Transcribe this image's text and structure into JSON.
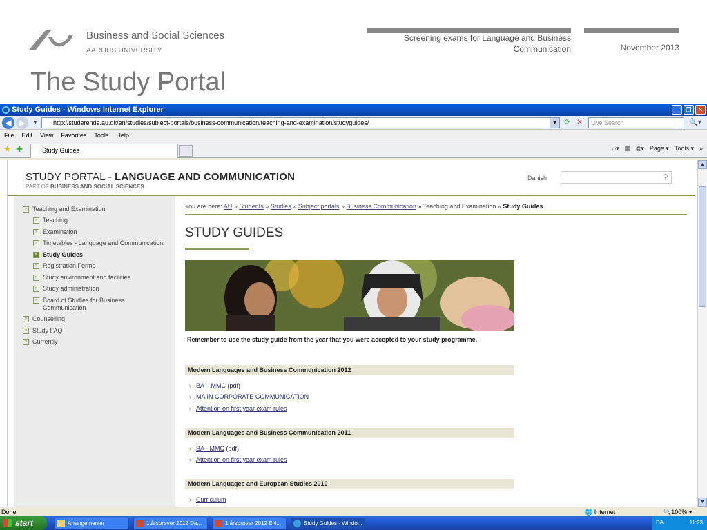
{
  "slide": {
    "institution": "Business and Social Sciences",
    "university": "AARHUS UNIVERSITY",
    "context_title": "Screening exams for Language and Business Communication",
    "date": "November  2013",
    "title": "The Study Portal"
  },
  "browser": {
    "window_title": "Study Guides - Windows Internet Explorer",
    "url": "http://studerende.au.dk/en/studies/subject-portals/business-communication/teaching-and-examination/studyguides/",
    "search_placeholder": "Live Search",
    "menu": [
      "File",
      "Edit",
      "View",
      "Favorites",
      "Tools",
      "Help"
    ],
    "tab_label": "Study Guides",
    "tab_tools": [
      "Page ▾",
      "Tools ▾"
    ],
    "status": "Done",
    "zone": "Internet",
    "zoom": "100%"
  },
  "portal": {
    "title_prefix": "STUDY PORTAL - ",
    "title_main": "LANGUAGE AND COMMUNICATION",
    "subtitle_prefix": "PART OF ",
    "subtitle_main": "BUSINESS AND SOCIAL SCIENCES",
    "language_link": "Danish"
  },
  "nav": [
    {
      "label": "Teaching and Examination",
      "level": 0,
      "active": false
    },
    {
      "label": "Teaching",
      "level": 1,
      "active": false
    },
    {
      "label": "Examination",
      "level": 1,
      "active": false
    },
    {
      "label": "Timetables - Language and Communication",
      "level": 1,
      "active": false
    },
    {
      "label": "Study Guides",
      "level": 1,
      "active": true
    },
    {
      "label": "Registration Forms",
      "level": 1,
      "active": false
    },
    {
      "label": "Study environment and facilities",
      "level": 1,
      "active": false
    },
    {
      "label": "Study administration",
      "level": 1,
      "active": false
    },
    {
      "label": "Board of Studies for Business",
      "label2": "Communication",
      "level": 1,
      "active": false
    },
    {
      "label": "Counselling",
      "level": 0,
      "active": false
    },
    {
      "label": "Study FAQ",
      "level": 0,
      "active": false
    },
    {
      "label": "Currently",
      "level": 0,
      "active": false
    }
  ],
  "breadcrumb": {
    "prefix": "You are here: ",
    "links": [
      "AU",
      "Students",
      "Studies",
      "Subject portals",
      "Business Communication"
    ],
    "plain": "Teaching and Examination",
    "current": "Study Guides",
    "sep": " » "
  },
  "content": {
    "heading": "STUDY GUIDES",
    "intro": "Remember to use the study guide from the year that you were accepted to your study programme.",
    "sections": [
      {
        "title": "Modern Languages and Business Communication 2012",
        "links": [
          {
            "text": "BA – MMC",
            "suffix": " (pdf)"
          },
          {
            "text": "MA IN CORPORATE COMMUNICATION",
            "suffix": ""
          },
          {
            "text": "Attention on first year exam rules",
            "suffix": ""
          }
        ]
      },
      {
        "title": "Modern Languages and Business Communication 2011",
        "links": [
          {
            "text": "BA - MMC",
            "suffix": " (pdf)"
          },
          {
            "text": "Attention on first year exam rules",
            "suffix": ""
          }
        ]
      },
      {
        "title": "Modern Languages and European Studies 2010",
        "links": [
          {
            "text": "Curriculum",
            "suffix": ""
          }
        ]
      }
    ]
  },
  "taskbar": {
    "start": "start",
    "items": [
      {
        "label": "Arrangementer",
        "icon": "folder-icon"
      },
      {
        "label": "1.årsprøver 2012 Da...",
        "icon": "powerpoint-icon"
      },
      {
        "label": "1.årsprøver 2012 EN...",
        "icon": "powerpoint-icon"
      },
      {
        "label": "Study Guides - Windo...",
        "icon": "ie-icon"
      }
    ],
    "language": "DA",
    "clock": "11:23"
  },
  "colors": {
    "accent_green": "#8a9a5b",
    "xp_blue": "#245edb",
    "slide_grey": "#777777"
  }
}
